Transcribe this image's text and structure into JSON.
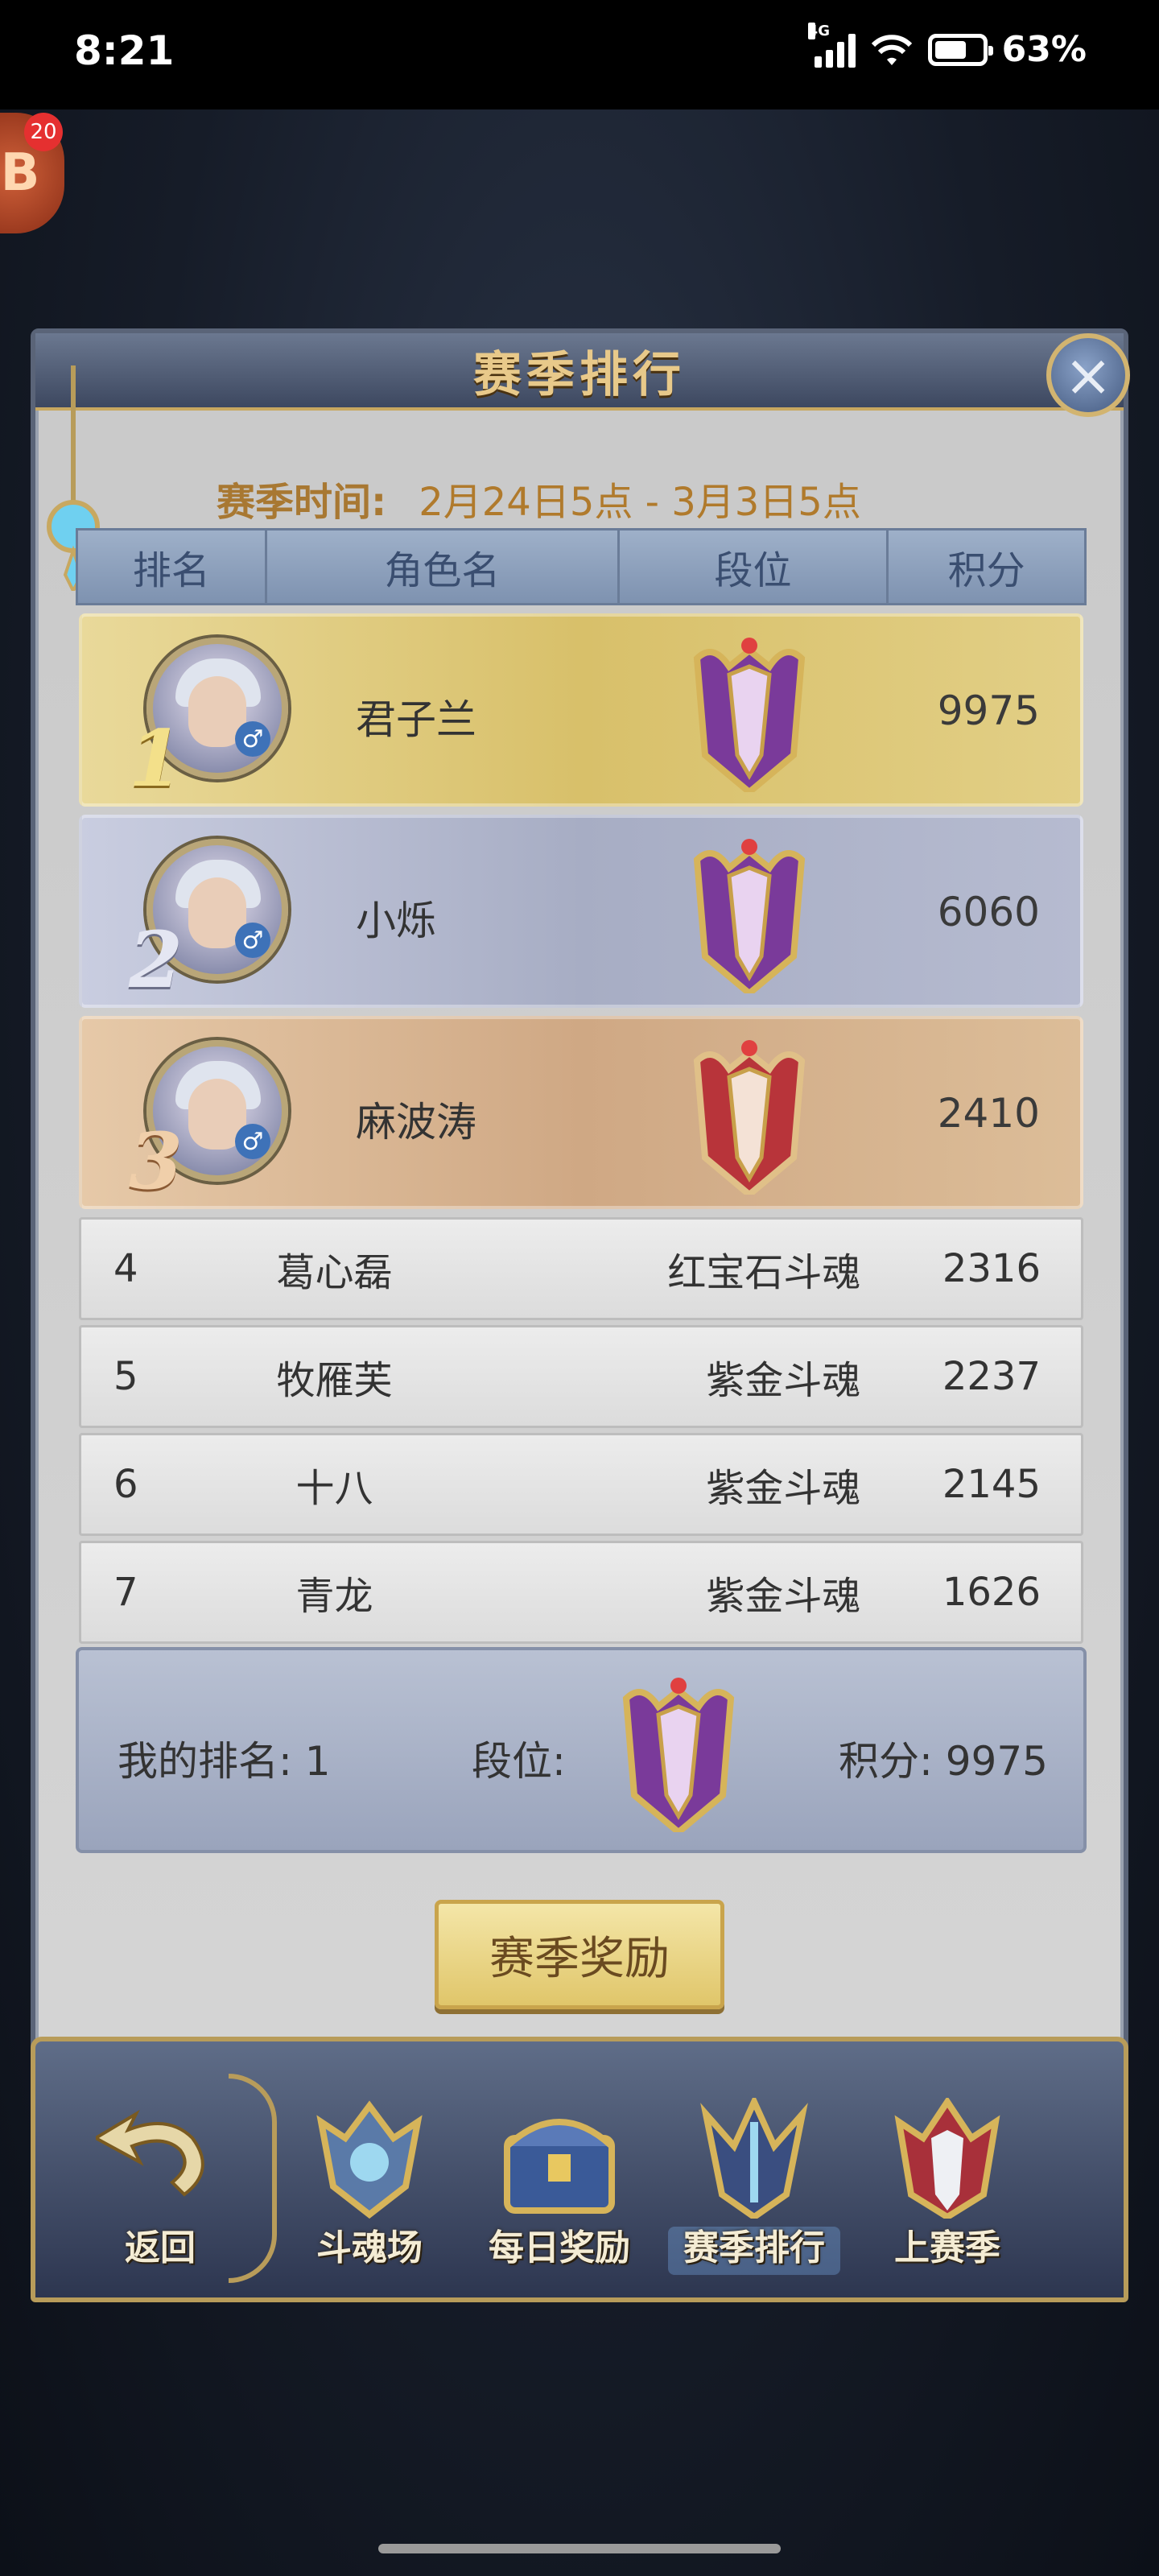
{
  "status_bar": {
    "time": "8:21",
    "network": "4G",
    "battery": "63%",
    "battery_level": 0.63
  },
  "floating_ball": {
    "badge": "20",
    "letter": "B"
  },
  "dialog": {
    "title": "赛季排行",
    "close_icon": "close-icon",
    "season_label": "赛季时间:",
    "season_range": "2月24日5点 - 3月3日5点"
  },
  "table": {
    "headers": [
      "排名",
      "角色名",
      "段位",
      "积分"
    ],
    "top_rows": [
      {
        "rank": "1",
        "name": "君子兰",
        "tier_icon": "purple-gold-emblem-icon",
        "score": "9975"
      },
      {
        "rank": "2",
        "name": "小烁",
        "tier_icon": "purple-gold-emblem-icon",
        "score": "6060"
      },
      {
        "rank": "3",
        "name": "麻波涛",
        "tier_icon": "ruby-emblem-icon",
        "score": "2410"
      }
    ],
    "rows": [
      {
        "rank": "4",
        "name": "葛心磊",
        "tier": "红宝石斗魂",
        "score": "2316"
      },
      {
        "rank": "5",
        "name": "牧雁芙",
        "tier": "紫金斗魂",
        "score": "2237"
      },
      {
        "rank": "6",
        "name": "十八",
        "tier": "紫金斗魂",
        "score": "2145"
      },
      {
        "rank": "7",
        "name": "青龙",
        "tier": "紫金斗魂",
        "score": "1626"
      }
    ]
  },
  "my_rank": {
    "rank_text": "我的排名: 1",
    "tier_label": "段位:",
    "score_text": "积分: 9975"
  },
  "season_reward_button": "赛季奖励",
  "nav": {
    "back": "返回",
    "items": [
      "斗魂场",
      "每日奖励",
      "赛季排行",
      "上赛季"
    ],
    "selected": "赛季排行"
  },
  "colors": {
    "gold": "#e8c98a",
    "panel": "#d0d0d0",
    "header_blue": "#8ea0bd"
  }
}
